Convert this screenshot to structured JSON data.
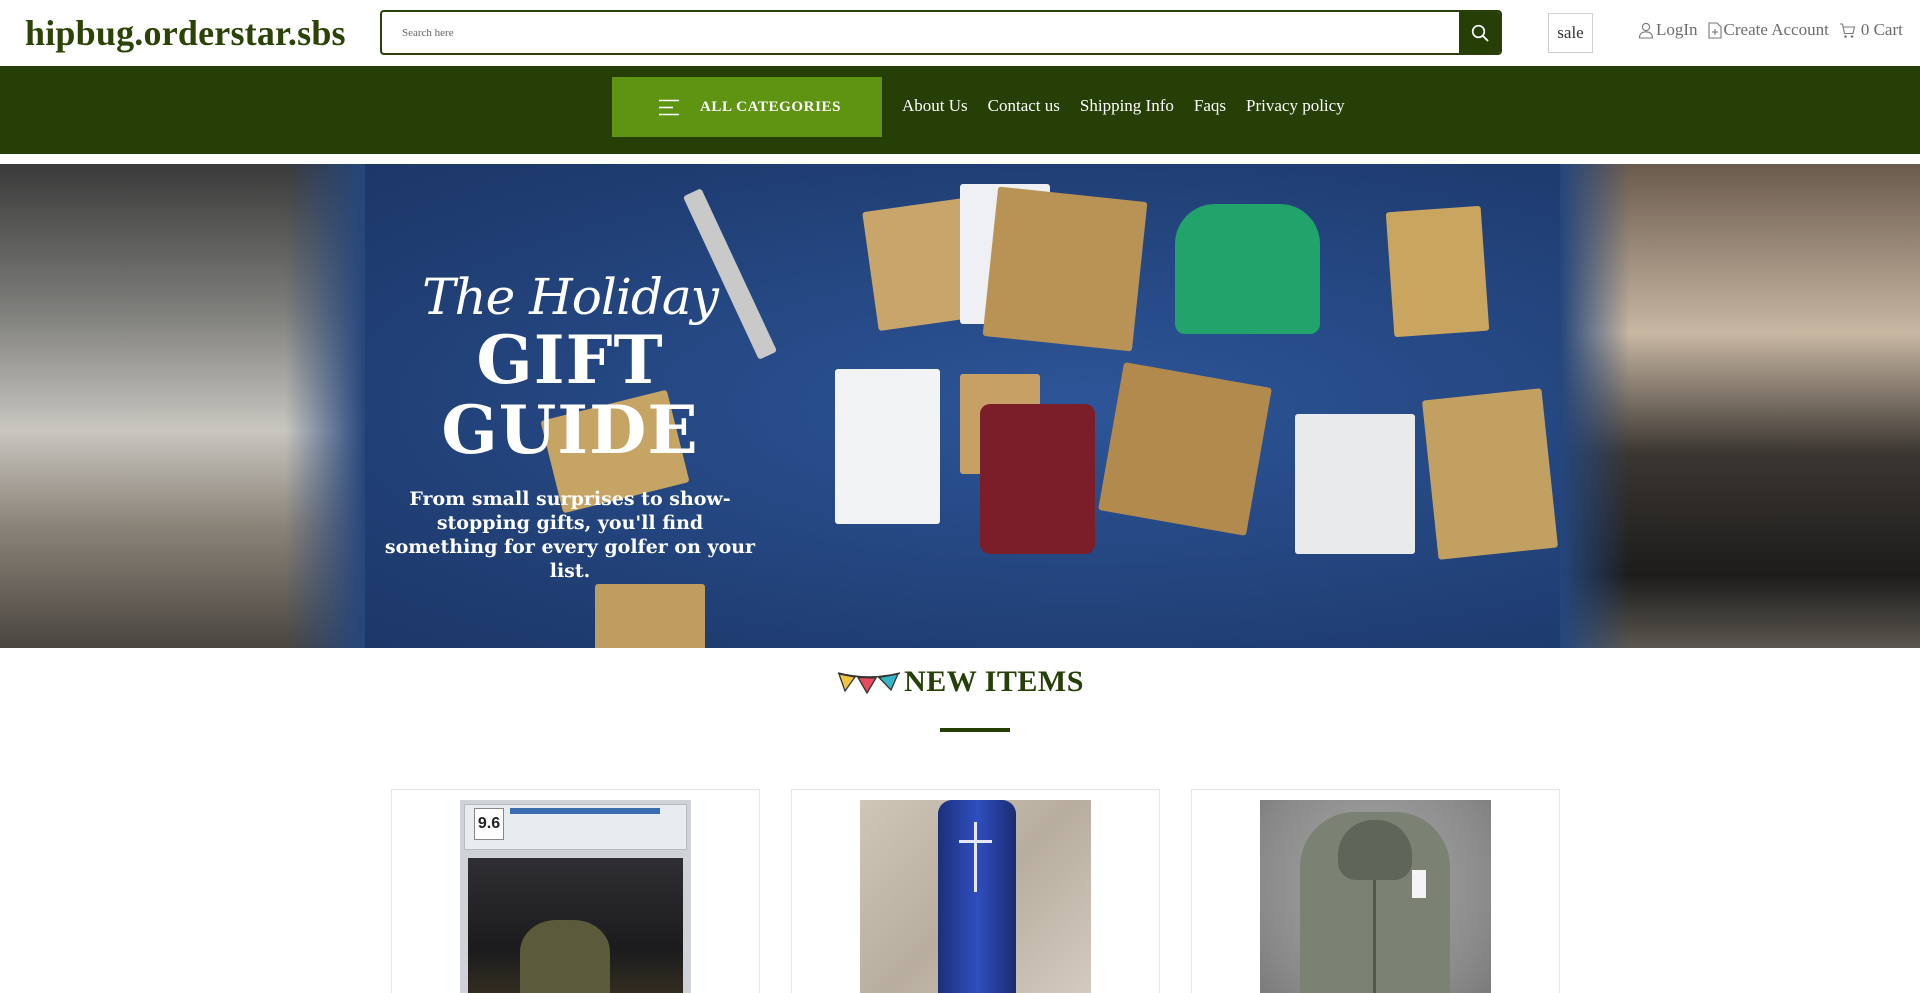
{
  "header": {
    "site_title": "hipbug.orderstar.sbs",
    "search_placeholder": "Search here",
    "sale_label": "sale",
    "login_label": "LogIn",
    "create_account_label": "Create Account",
    "cart_label": "0 Cart"
  },
  "nav": {
    "all_categories_label": "ALL CATEGORIES",
    "links": [
      "About Us",
      "Contact us",
      "Shipping Info",
      "Faqs",
      "Privacy policy"
    ]
  },
  "hero": {
    "script_text": "The Holiday",
    "title": "GIFT GUIDE",
    "subtitle": "From small surprises to show-stopping gifts, you'll find something for every golfer on your list."
  },
  "new_items": {
    "title": "NEW ITEMS",
    "products": [
      {
        "image_desc": "graded-comic-image",
        "slab_grade": "9.6"
      },
      {
        "image_desc": "blue-speaker-image"
      },
      {
        "image_desc": "grey-jacket-image"
      }
    ]
  },
  "colors": {
    "brand_dark_green": "#263f06",
    "accent_green": "#5f9413",
    "hero_blue": "#25467d"
  }
}
